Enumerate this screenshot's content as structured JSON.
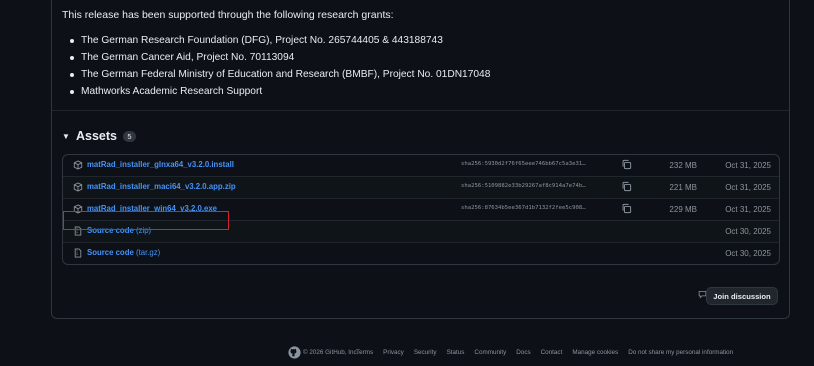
{
  "intro": "This release has been supported through the following research grants:",
  "grants": [
    "The German Research Foundation (DFG), Project No. 265744405 & 443188743",
    "The German Cancer Aid, Project No. 70113094",
    "The German Federal Ministry of Education and Research (BMBF), Project No. 01DN17048",
    "Mathworks Academic Research Support"
  ],
  "assets": {
    "title": "Assets",
    "count": "5",
    "items": [
      {
        "name": "matRad_installer_glnxa64_v3.2.0.install",
        "sha": "sha256:5930d2f76f65eee746bb67c5a3e31…",
        "size": "232 MB",
        "date": "Oct 31, 2025",
        "icon": "package-icon"
      },
      {
        "name": "matRad_installer_maci64_v3.2.0.app.zip",
        "sha": "sha256:5109882e33b29267af8c914a7e74b…",
        "size": "221 MB",
        "date": "Oct 31, 2025",
        "icon": "package-icon"
      },
      {
        "name": "matRad_installer_win64_v3.2.0.exe",
        "sha": "sha256:87634b5ee367d1b7132f2fee5c908…",
        "size": "229 MB",
        "date": "Oct 31, 2025",
        "icon": "package-icon",
        "highlighted": true
      },
      {
        "name": "Source code",
        "suffix": "(zip)",
        "date": "Oct 30, 2025",
        "icon": "file-zip-icon"
      },
      {
        "name": "Source code",
        "suffix": "(tar.gz)",
        "date": "Oct 30, 2025",
        "icon": "file-zip-icon"
      }
    ]
  },
  "discussion": {
    "comment_count": "0",
    "join_label": "Join discussion"
  },
  "footer": {
    "copyright": "© 2026 GitHub, Inc.",
    "links": [
      "Terms",
      "Privacy",
      "Security",
      "Status",
      "Community",
      "Docs",
      "Contact",
      "Manage cookies",
      "Do not share my personal information"
    ]
  },
  "colors": {
    "link": "#4493f8",
    "highlight": "#d1242f",
    "background": "#0d1117"
  }
}
